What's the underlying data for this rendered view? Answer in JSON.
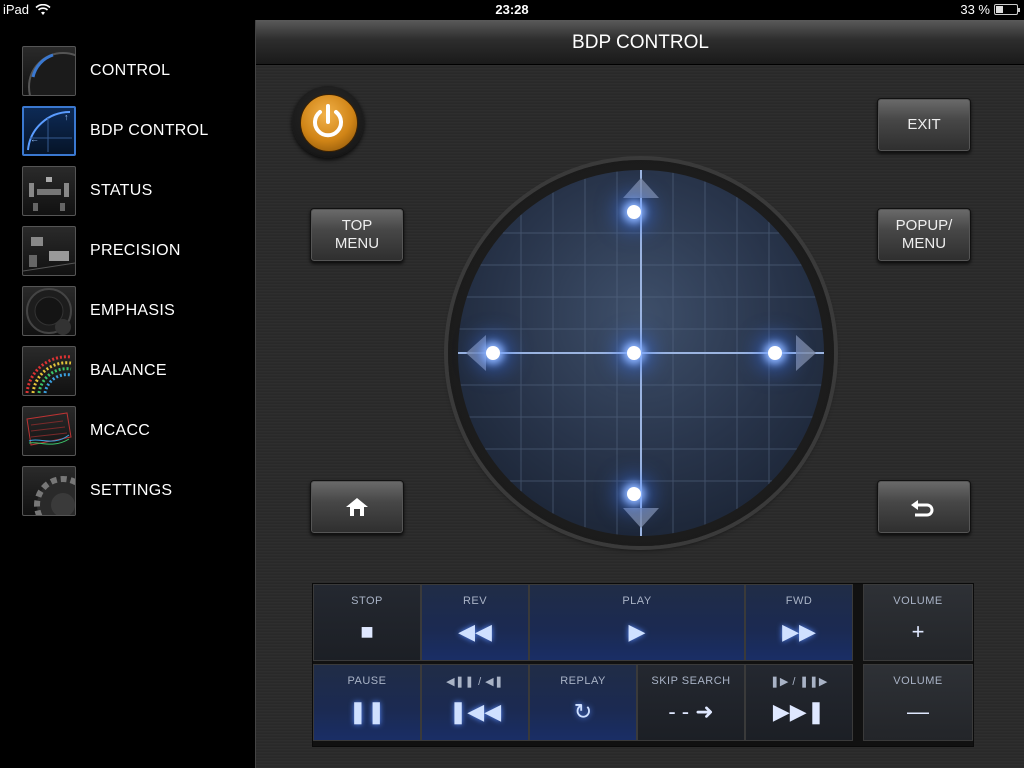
{
  "statusbar": {
    "device": "iPad",
    "time": "23:28",
    "battery": "33 %",
    "battery_level": 0.33
  },
  "sidebar": {
    "items": [
      {
        "label": "CONTROL"
      },
      {
        "label": "BDP CONTROL"
      },
      {
        "label": "STATUS"
      },
      {
        "label": "PRECISION"
      },
      {
        "label": "EMPHASIS"
      },
      {
        "label": "BALANCE"
      },
      {
        "label": "MCACC"
      },
      {
        "label": "SETTINGS"
      }
    ],
    "active": "BDP CONTROL"
  },
  "header": {
    "title": "BDP CONTROL"
  },
  "buttons": {
    "exit": "EXIT",
    "top_menu": "TOP\nMENU",
    "popup_menu": "POPUP/\nMENU"
  },
  "transport": {
    "stop": {
      "label": "STOP",
      "icon": "■"
    },
    "rev": {
      "label": "REV",
      "icon": "◀◀"
    },
    "play": {
      "label": "PLAY",
      "icon": "▶"
    },
    "fwd": {
      "label": "FWD",
      "icon": "▶▶"
    },
    "volume_up": {
      "label": "VOLUME",
      "icon": "+"
    },
    "pause": {
      "label": "PAUSE",
      "icon": "❚❚"
    },
    "step_back": {
      "label": "◀❚❚ / ◀❚",
      "icon": "❚◀◀"
    },
    "replay": {
      "label": "REPLAY",
      "icon": "↻"
    },
    "skip_search": {
      "label": "SKIP SEARCH",
      "icon": "- - ➜"
    },
    "step_fwd": {
      "label": "❚▶ / ❚❚▶",
      "icon": "▶▶❚"
    },
    "volume_down": {
      "label": "VOLUME",
      "icon": "—"
    }
  },
  "colors": {
    "accent": "#3a78d0",
    "power": "#d08416",
    "glow": "#8fb6ff"
  }
}
